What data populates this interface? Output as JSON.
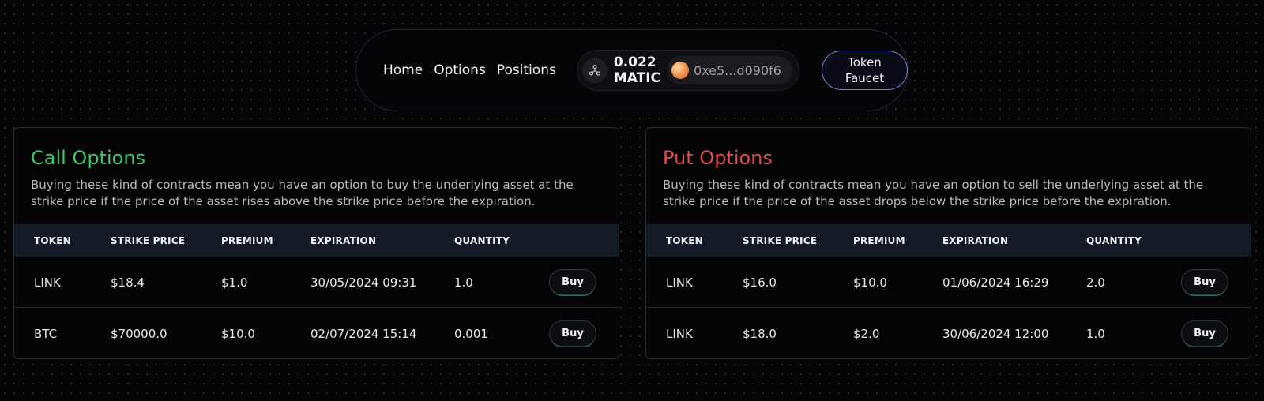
{
  "nav": {
    "links": [
      "Home",
      "Options",
      "Positions"
    ],
    "balance_amount": "0.022",
    "balance_symbol": "MATIC",
    "address": "0xe5...d090f6",
    "faucet_line1": "Token",
    "faucet_line2": "Faucet"
  },
  "colors": {
    "call": "#3ec46a",
    "put": "#e24a4a",
    "faucet_border": "#7d86d4"
  },
  "icons": {
    "chain": "polygon-network-icon",
    "avatar": "wallet-avatar-icon"
  },
  "call": {
    "title": "Call Options",
    "description": "Buying these kind of contracts mean you have an option to buy the underlying asset at the strike price if the price of the asset rises above the strike price before the expiration.",
    "columns": [
      "TOKEN",
      "STRIKE PRICE",
      "PREMIUM",
      "EXPIRATION",
      "QUANTITY"
    ],
    "rows": [
      {
        "token": "LINK",
        "strike": "$18.4",
        "premium": "$1.0",
        "expiration": "30/05/2024 09:31",
        "quantity": "1.0",
        "action": "Buy"
      },
      {
        "token": "BTC",
        "strike": "$70000.0",
        "premium": "$10.0",
        "expiration": "02/07/2024 15:14",
        "quantity": "0.001",
        "action": "Buy"
      }
    ]
  },
  "put": {
    "title": "Put Options",
    "description": "Buying these kind of contracts mean you have an option to sell the underlying asset at the strike price if the price of the asset drops below the strike price before the expiration.",
    "columns": [
      "TOKEN",
      "STRIKE PRICE",
      "PREMIUM",
      "EXPIRATION",
      "QUANTITY"
    ],
    "rows": [
      {
        "token": "LINK",
        "strike": "$16.0",
        "premium": "$10.0",
        "expiration": "01/06/2024 16:29",
        "quantity": "2.0",
        "action": "Buy"
      },
      {
        "token": "LINK",
        "strike": "$18.0",
        "premium": "$2.0",
        "expiration": "30/06/2024 12:00",
        "quantity": "1.0",
        "action": "Buy"
      }
    ]
  }
}
